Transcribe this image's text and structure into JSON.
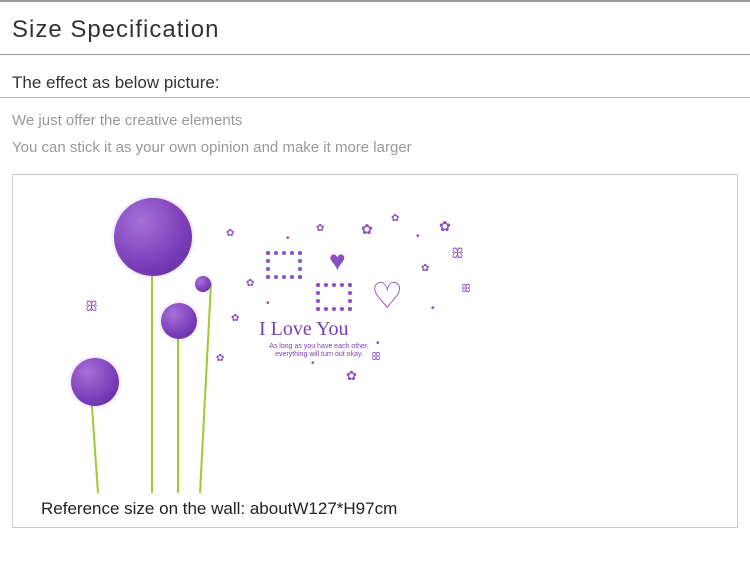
{
  "section_title": "Size Specification",
  "subtitle": "The effect as below picture:",
  "desc1": "We just offer the creative elements",
  "desc2": "You can stick it as your own opinion and make it more larger",
  "script_label": "I Love You",
  "small_line1": "As long as you have each other,",
  "small_line2": "everything will turn out okay.",
  "reference_label": "Reference size on the wall: aboutW127*H97cm"
}
